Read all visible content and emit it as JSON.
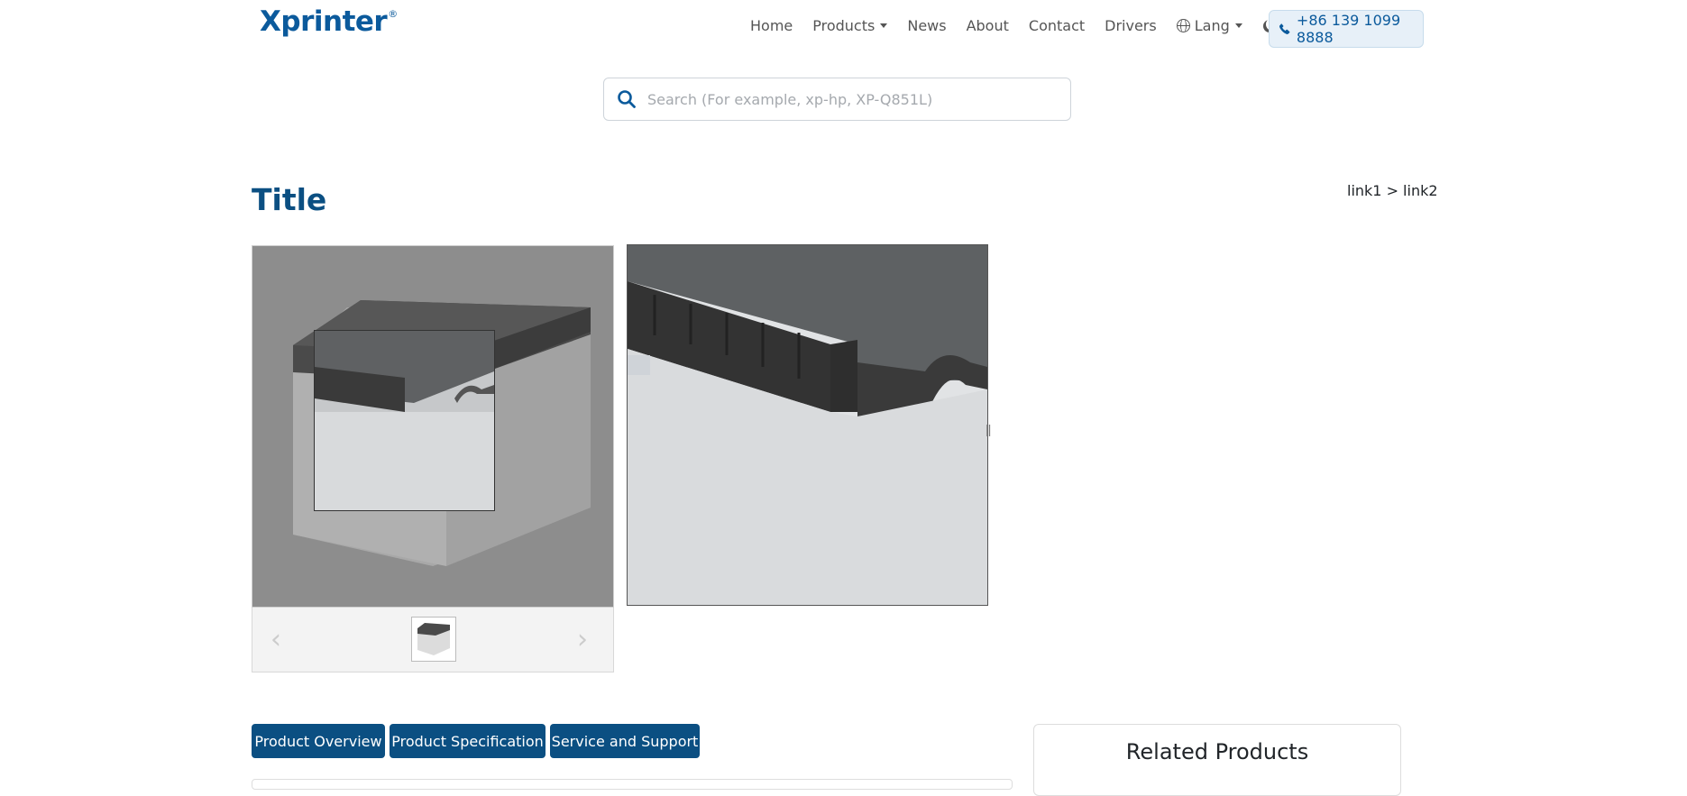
{
  "header": {
    "logo_text": "Xprinter",
    "logo_mark": "®",
    "nav": [
      {
        "label": "Home"
      },
      {
        "label": "Products"
      },
      {
        "label": "News"
      },
      {
        "label": "About"
      },
      {
        "label": "Contact"
      },
      {
        "label": "Drivers"
      },
      {
        "label": "Lang"
      }
    ],
    "phone_label": "+86 139 1099 8888",
    "icons": [
      "globe-icon",
      "moon-icon",
      "phone-icon",
      "caret-icon"
    ]
  },
  "search": {
    "placeholder": "Search (For example, xp-hp, XP-Q851L)",
    "value": ""
  },
  "page": {
    "title": "Title",
    "breadcrumb": "link1 > link2"
  },
  "gallery": {
    "prev_label": "‹",
    "next_label": "›",
    "zoom_cursor": "ǁ"
  },
  "tabs": [
    {
      "label": "Product Overview"
    },
    {
      "label": "Product Specification"
    },
    {
      "label": "Service and Support"
    }
  ],
  "related": {
    "title": "Related Products"
  },
  "colors": {
    "brand": "#0b5a9c",
    "tab_bg": "#0b4f82",
    "phone_bg": "#e7f0f8"
  }
}
